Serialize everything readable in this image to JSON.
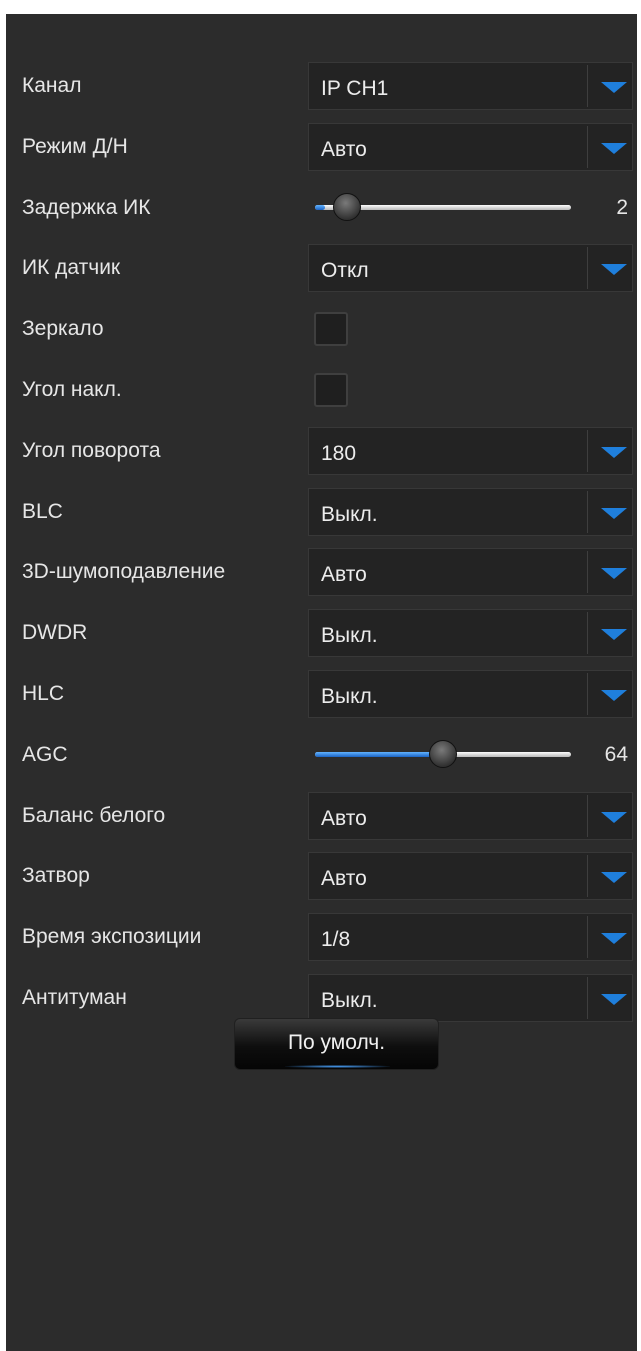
{
  "settings": [
    {
      "label": "Канал",
      "type": "select",
      "value": "IP CH1"
    },
    {
      "label": "Режим Д/Н",
      "type": "select",
      "value": "Авто"
    },
    {
      "label": "Задержка ИК",
      "type": "slider",
      "value": "2",
      "level": 0.04
    },
    {
      "label": "ИК датчик",
      "type": "select",
      "value": "Откл"
    },
    {
      "label": "Зеркало",
      "type": "checkbox",
      "checked": false
    },
    {
      "label": "Угол накл.",
      "type": "checkbox",
      "checked": false
    },
    {
      "label": "Угол поворота",
      "type": "select",
      "value": "180"
    },
    {
      "label": "BLC",
      "type": "select",
      "value": "Выкл."
    },
    {
      "label": "3D-шумоподавление",
      "type": "select",
      "value": "Авто"
    },
    {
      "label": "DWDR",
      "type": "select",
      "value": "Выкл."
    },
    {
      "label": "HLC",
      "type": "select",
      "value": "Выкл."
    },
    {
      "label": "AGC",
      "type": "slider",
      "value": "64",
      "level": 0.5
    },
    {
      "label": "Баланс белого",
      "type": "select",
      "value": "Авто"
    },
    {
      "label": "Затвор",
      "type": "select",
      "value": "Авто"
    },
    {
      "label": "Время экспозиции",
      "type": "select",
      "value": "1/8"
    },
    {
      "label": "Антитуман",
      "type": "select",
      "value": "Выкл."
    }
  ],
  "default_button": {
    "label": "По умолч."
  },
  "colors": {
    "panel_background": "#2c2c2c",
    "accent": "#1f7fdc",
    "text": "#e6e6e6"
  },
  "icons": {
    "dropdown": "chevron-down-icon"
  }
}
